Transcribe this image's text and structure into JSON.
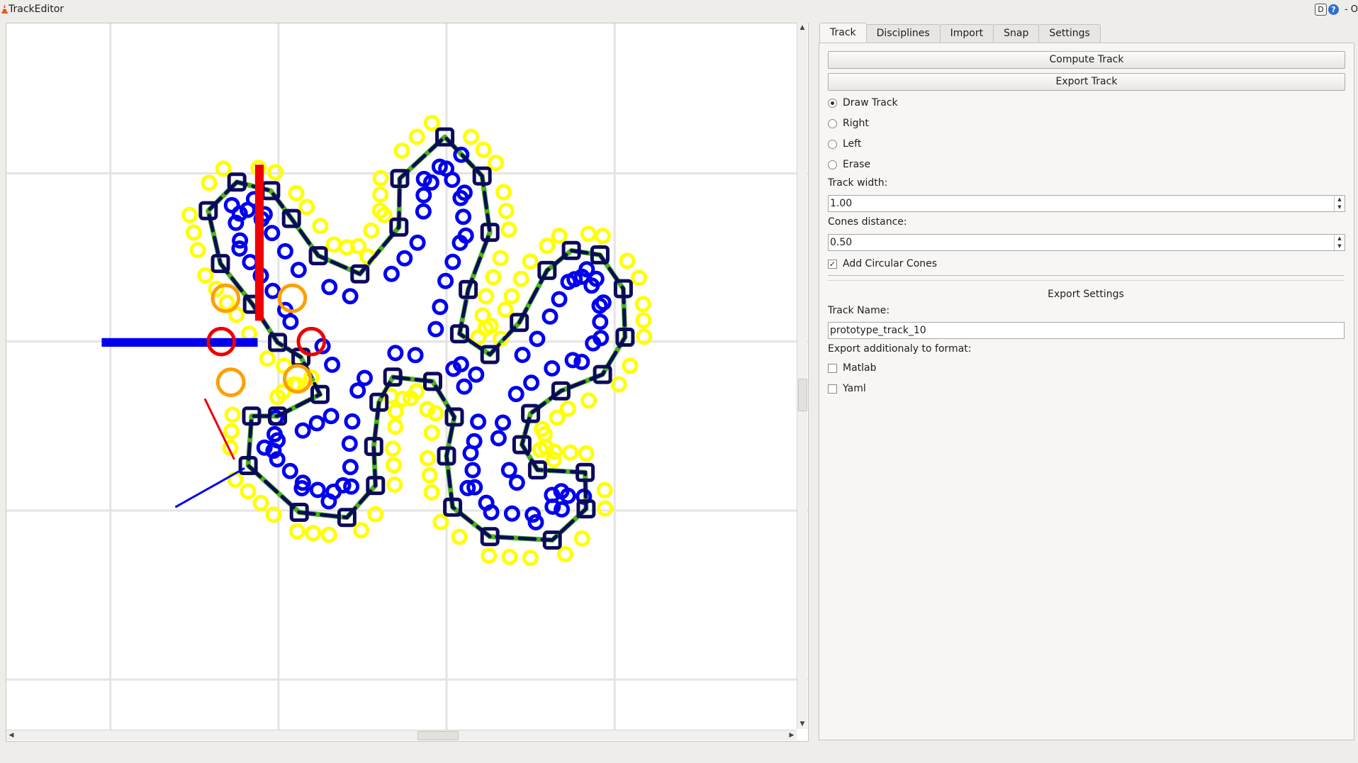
{
  "window": {
    "title": "TrackEditor",
    "controls": [
      "D",
      "?",
      "- O"
    ]
  },
  "tabs": [
    {
      "label": "Track",
      "active": true
    },
    {
      "label": "Disciplines",
      "active": false
    },
    {
      "label": "Import",
      "active": false
    },
    {
      "label": "Snap",
      "active": false
    },
    {
      "label": "Settings",
      "active": false
    }
  ],
  "track_tab": {
    "compute_label": "Compute Track",
    "export_label": "Export Track",
    "modes": [
      {
        "label": "Draw Track",
        "selected": true
      },
      {
        "label": "Right",
        "selected": false
      },
      {
        "label": "Left",
        "selected": false
      },
      {
        "label": "Erase",
        "selected": false
      }
    ],
    "track_width_label": "Track width:",
    "track_width_value": "1.00",
    "cones_distance_label": "Cones distance:",
    "cones_distance_value": "0.50",
    "circular_cones_label": "Add Circular Cones",
    "circular_cones_checked": true,
    "export_settings_title": "Export Settings",
    "track_name_label": "Track Name:",
    "track_name_value": "prototype_track_10",
    "export_format_label": "Export additionaly to format:",
    "formats": [
      {
        "label": "Matlab",
        "checked": false
      },
      {
        "label": "Yaml",
        "checked": false
      }
    ]
  },
  "colors": {
    "centerline": "#4cb31e",
    "control_points": "#0c0a5c",
    "blue_cones": "#0000ee",
    "yellow_cones": "#ffff00",
    "orange_cones": "#ff9f00",
    "red_markers": "#ee0000",
    "grid": "#e4e4e4"
  },
  "icons": {
    "app": "traffic-cone-icon",
    "help": "help-icon"
  }
}
